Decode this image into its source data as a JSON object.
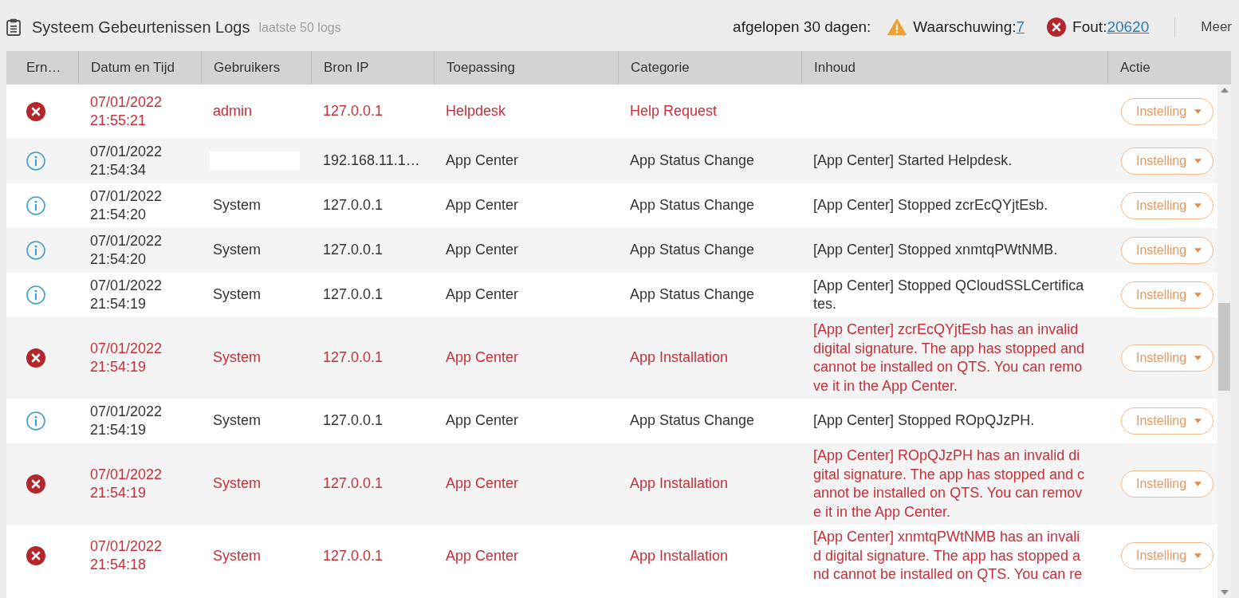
{
  "header": {
    "title": "Systeem Gebeurtenissen Logs",
    "subtitle": "laatste 50 logs",
    "period_label": "afgelopen 30 dagen:",
    "warning": {
      "label": "Waarschuwing:",
      "count": "7"
    },
    "error": {
      "label": "Fout:",
      "count": "20620"
    },
    "more": "Meer"
  },
  "table": {
    "columns": [
      "Ern…",
      "Datum en Tijd",
      "Gebruikers",
      "Bron IP",
      "Toepassing",
      "Categorie",
      "Inhoud",
      "Actie"
    ],
    "rows": [
      {
        "kind": "error",
        "datetime": "07/01/2022 21:55:21",
        "user_redacted": false,
        "user": "admin",
        "source_ip": "127.0.0.1",
        "application": "Helpdesk",
        "category": "Help Request",
        "action": "Instelling"
      },
      {
        "kind": "info",
        "datetime": "07/01/2022 21:54:34",
        "user_redacted": true,
        "source_ip": "192.168.11.1…",
        "application": "App Center",
        "category": "App Status Change",
        "content": "[App Center] Started Helpdesk.",
        "action": "Instelling"
      },
      {
        "kind": "info",
        "datetime": "07/01/2022 21:54:20",
        "user_redacted": false,
        "user": "System",
        "source_ip": "127.0.0.1",
        "application": "App Center",
        "category": "App Status Change",
        "content": "[App Center] Stopped zcrEcQYjtEsb.",
        "action": "Instelling"
      },
      {
        "kind": "info",
        "datetime": "07/01/2022 21:54:20",
        "user_redacted": false,
        "user": "System",
        "source_ip": "127.0.0.1",
        "application": "App Center",
        "category": "App Status Change",
        "content": "[App Center] Stopped xnmtqPWtNMB.",
        "action": "Instelling"
      },
      {
        "kind": "info",
        "datetime": "07/01/2022 21:54:19",
        "user_redacted": false,
        "user": "System",
        "source_ip": "127.0.0.1",
        "application": "App Center",
        "category": "App Status Change",
        "content": "[App Center] Stopped QCloudSSLCertificates.",
        "action": "Instelling"
      },
      {
        "kind": "error",
        "datetime": "07/01/2022 21:54:19",
        "user_redacted": false,
        "user": "System",
        "source_ip": "127.0.0.1",
        "application": "App Center",
        "category": "App Installation",
        "content": "[App Center] zcrEcQYjtEsb has an invalid digital signature. The app has stopped and cannot be installed on QTS. You can remove it in the App Center.",
        "action": "Instelling"
      },
      {
        "kind": "info",
        "datetime": "07/01/2022 21:54:19",
        "user_redacted": false,
        "user": "System",
        "source_ip": "127.0.0.1",
        "application": "App Center",
        "category": "App Status Change",
        "content": "[App Center] Stopped ROpQJzPH.",
        "action": "Instelling"
      },
      {
        "kind": "error",
        "datetime": "07/01/2022 21:54:19",
        "user_redacted": false,
        "user": "System",
        "source_ip": "127.0.0.1",
        "application": "App Center",
        "category": "App Installation",
        "content": "[App Center] ROpQJzPH has an invalid digital signature. The app has stopped and cannot be installed on QTS. You can remove it in the App Center.",
        "action": "Instelling"
      },
      {
        "kind": "error",
        "datetime": "07/01/2022 21:54:18",
        "user_redacted": false,
        "user": "System",
        "source_ip": "127.0.0.1",
        "application": "App Center",
        "category": "App Installation",
        "content": "[App Center] xnmtqPWtNMB has an invalid digital signature. The app has stopped and cannot be installed on QTS. You can re",
        "action": "Instelling"
      }
    ]
  }
}
